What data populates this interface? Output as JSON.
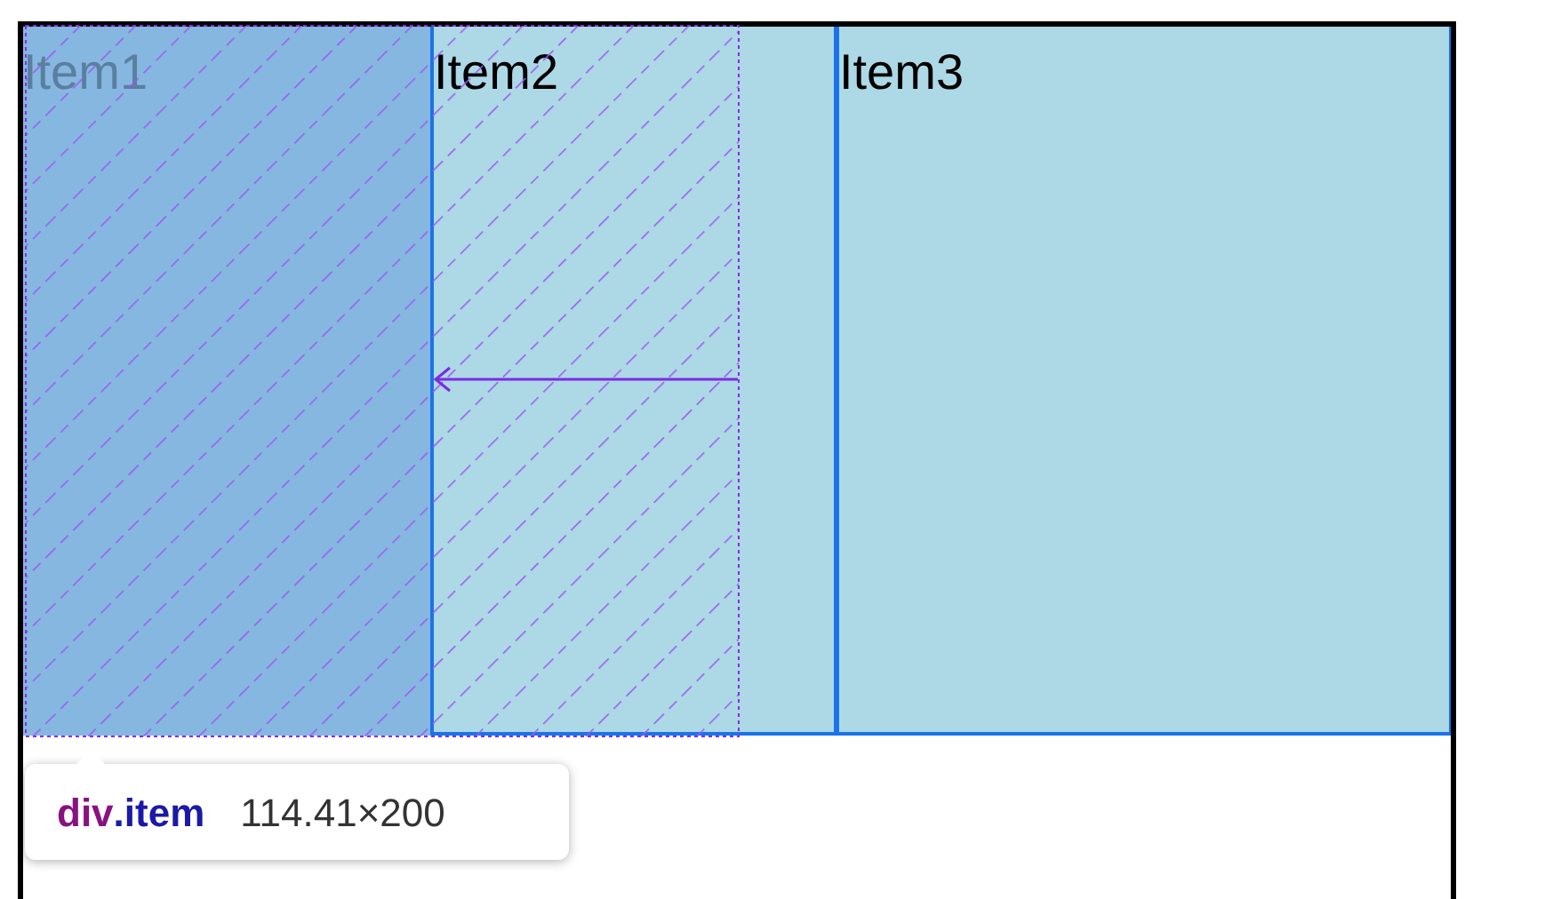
{
  "items": [
    {
      "label": "Item1",
      "selected": true
    },
    {
      "label": "Item2",
      "selected": false
    },
    {
      "label": "Item3",
      "selected": false
    }
  ],
  "tooltip": {
    "tag": "div",
    "class_name": ".item",
    "size": "114.41×200"
  }
}
